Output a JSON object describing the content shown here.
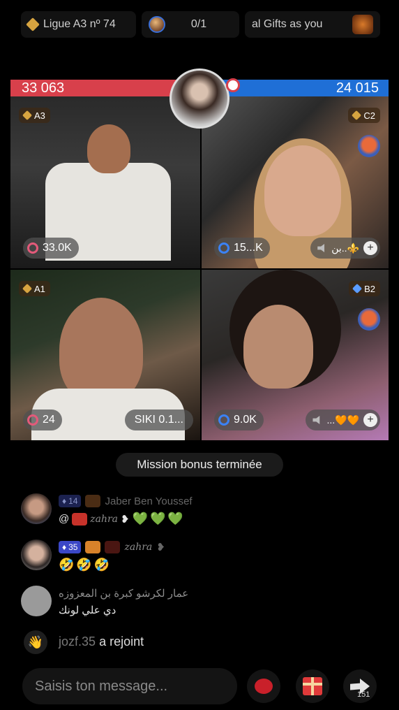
{
  "topbar": {
    "league": "Ligue A3 nº 74",
    "score": "0/1",
    "gifts_text": "al Gifts as you"
  },
  "battle": {
    "left_score": "33 063",
    "right_score": "24 015",
    "colors": {
      "left": "#d8404b",
      "right": "#1f6fd6"
    }
  },
  "tiles": [
    {
      "rank": "A3",
      "likes": "33.0K"
    },
    {
      "rank": "C2",
      "likes": "15...K",
      "guest": "بن..⚜️"
    },
    {
      "rank": "A1",
      "likes": "24",
      "guest_name": "SIKI 0.1..."
    },
    {
      "rank": "B2",
      "likes": "9.0K",
      "guest": "...🧡🧡"
    }
  ],
  "toast": "Mission bonus terminée",
  "chat": {
    "msg1": {
      "level": "14",
      "name": "Jaber Ben Youssef",
      "at": "@",
      "sig": "zahra",
      "hearts": "💚💚💚"
    },
    "msg2": {
      "level": "35",
      "sig": "zahra",
      "emojis": "🤣🤣🤣"
    },
    "msg3": {
      "name": "عمار لكرشو كبرة بن المعزوزه",
      "text": "دي علي لونك"
    },
    "msg4": {
      "user": "jozf.35",
      "text": "a rejoint"
    }
  },
  "input": {
    "placeholder": "Saisis ton message..."
  },
  "share_count": "151"
}
